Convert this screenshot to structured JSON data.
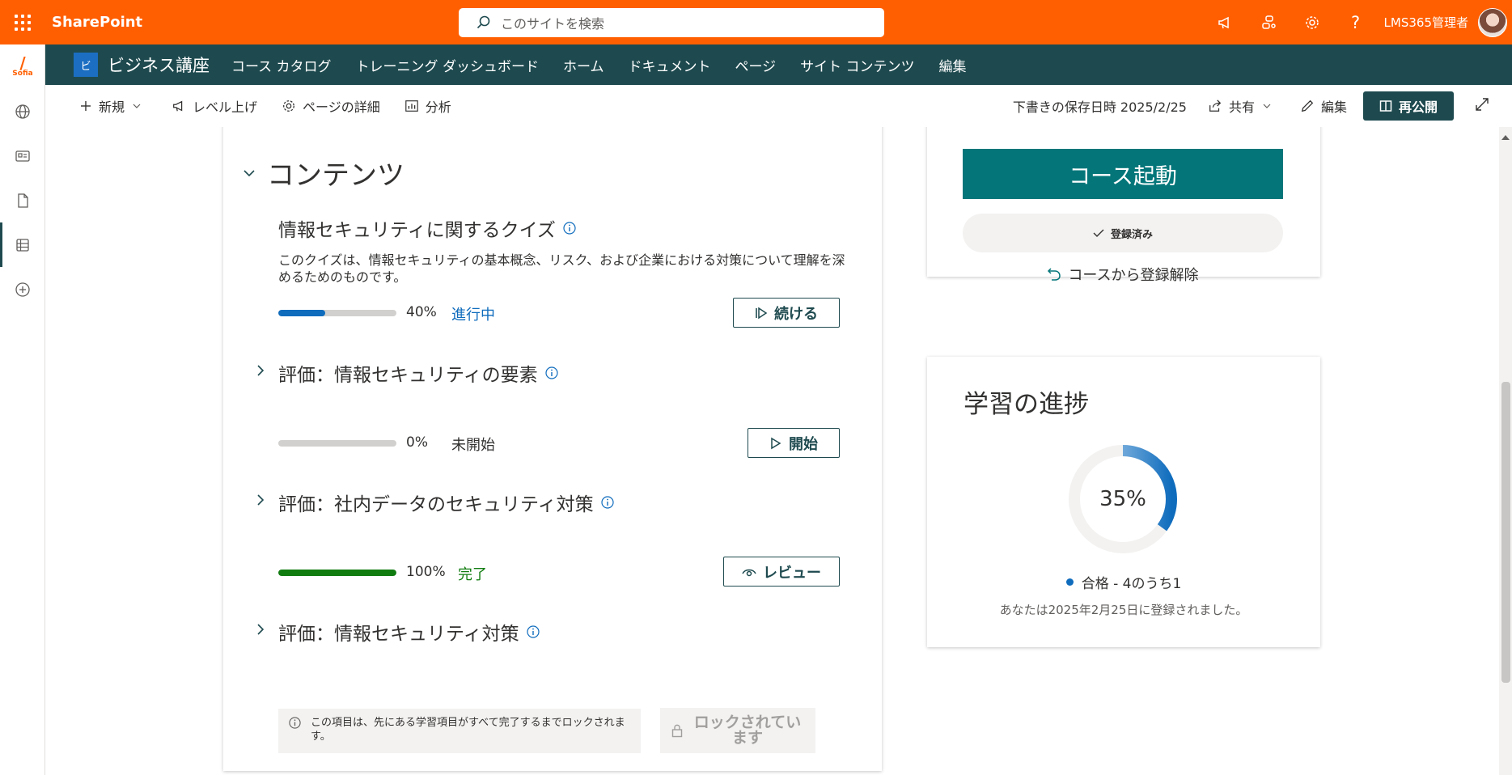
{
  "suite": {
    "brand": "SharePoint",
    "search_placeholder": "このサイトを検索",
    "user_name": "LMS365管理者"
  },
  "site": {
    "logo_letter": "ビ",
    "title": "ビジネス講座",
    "nav": [
      "コース カタログ",
      "トレーニング ダッシュボード",
      "ホーム",
      "ドキュメント",
      "ページ",
      "サイト コンテンツ",
      "編集"
    ]
  },
  "command_bar": {
    "new": "新規",
    "promote": "レベル上げ",
    "page_details": "ページの詳細",
    "analytics": "分析",
    "draft_saved": "下書きの保存日時 2025/2/25",
    "share": "共有",
    "edit": "編集",
    "republish": "再公開"
  },
  "contents": {
    "section_title": "コンテンツ",
    "items": [
      {
        "title": "情報セキュリティに関するクイズ",
        "description": "このクイズは、情報セキュリティの基本概念、リスク、および企業における対策について理解を深めるためのものです。",
        "progress": 40,
        "progress_label": "40%",
        "status": "進行中",
        "button": "続ける"
      },
      {
        "title": "評価：情報セキュリティの要素",
        "progress": 0,
        "progress_label": "0%",
        "status": "未開始",
        "button": "開始"
      },
      {
        "title": "評価：社内データのセキュリティ対策",
        "progress": 100,
        "progress_label": "100%",
        "status": "完了",
        "button": "レビュー"
      },
      {
        "title": "評価：情報セキュリティ対策",
        "lock_note": "この項目は、先にある学習項目がすべて完了するまでロックされます。",
        "button": "ロックされています"
      }
    ]
  },
  "course": {
    "launch": "コース起動",
    "enrolled": "登録済み",
    "unenroll": "コースから登録解除"
  },
  "learning_progress": {
    "title": "学習の進捗",
    "percent": 35,
    "percent_label": "35%",
    "legend": "合格 - 4のうち1",
    "enrolled_date": "あなたは2025年2月25日に登録されました。"
  },
  "colors": {
    "suite_bar": "#ff5f00",
    "site_header": "#1e4a4f",
    "launch_button": "#04767a",
    "progress_blue": "#0f6cbd",
    "progress_green": "#107c10"
  }
}
